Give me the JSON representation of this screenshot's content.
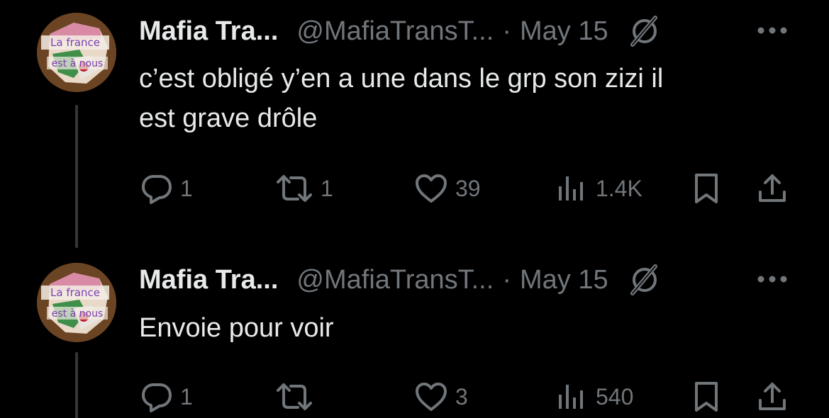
{
  "tweets": [
    {
      "author_name": "Mafia Tra...",
      "handle": "@MafiaTransT...",
      "separator": "·",
      "date": "May 15",
      "text_lines": [
        "c’est obligé y’en a une dans le grp son zizi il",
        "est grave drôle"
      ],
      "avatar_text": [
        "La france",
        "est à nous"
      ],
      "counts": {
        "replies": "1",
        "retweets": "1",
        "likes": "39",
        "views": "1.4K"
      }
    },
    {
      "author_name": "Mafia Tra...",
      "handle": "@MafiaTransT...",
      "separator": "·",
      "date": "May 15",
      "text_lines": [
        "Envoie pour voir"
      ],
      "avatar_text": [
        "La france",
        "est à nous"
      ],
      "counts": {
        "replies": "1",
        "retweets": "",
        "likes": "3",
        "views": "540"
      }
    }
  ],
  "icons": {
    "reply": "reply-icon",
    "retweet": "retweet-icon",
    "like": "heart-icon",
    "views": "views-icon",
    "bookmark": "bookmark-icon",
    "share": "share-icon",
    "verified": "verified-badge-icon",
    "more": "more-icon"
  },
  "colors": {
    "background": "#000000",
    "primary_text": "#e7e9ea",
    "secondary_text": "#71767b",
    "thread_line": "#333639"
  }
}
